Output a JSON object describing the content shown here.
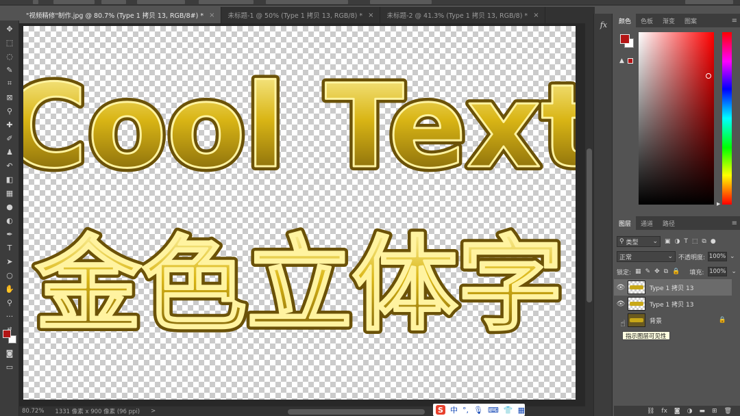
{
  "document_tabs": [
    {
      "label": "\"视频精修\"制作.jpg @ 80.7% (Type 1 拷贝 13, RGB/8#) *",
      "active": true
    },
    {
      "label": "未标题-1 @ 50% (Type 1 拷贝 13, RGB/8) *",
      "active": false
    },
    {
      "label": "未标题-2 @ 41.3% (Type 1 拷贝 13, RGB/8) *",
      "active": false
    }
  ],
  "tab_close": "×",
  "canvas_text": {
    "line1": "Cool Text",
    "line2": "金色立体字"
  },
  "status_bar": {
    "zoom": "80.72%",
    "doc_size": "1331 像素 x 900 像素 (96 ppi)",
    "arrow": ">"
  },
  "ime": {
    "logo": "S",
    "lang": "中",
    "punct": "°,"
  },
  "color_panel": {
    "tabs": [
      "颜色",
      "色板",
      "渐变",
      "图案"
    ],
    "menu": "≡",
    "foreground": "#b41515",
    "background": "#ffffff"
  },
  "layers_panel": {
    "tabs": [
      "图层",
      "通道",
      "路径"
    ],
    "menu": "≡",
    "filter_kind": "类型",
    "blend_mode": "正常",
    "opacity_label": "不透明度:",
    "opacity_value": "100%",
    "lock_label": "锁定:",
    "fill_label": "填充:",
    "fill_value": "100%",
    "layers": [
      {
        "name": "Type 1 拷贝  13",
        "visible": true,
        "selected": true
      },
      {
        "name": "Type 1 拷贝  13",
        "visible": true,
        "selected": false
      },
      {
        "name": "背景",
        "visible": false,
        "selected": false,
        "locked": true
      }
    ],
    "tooltip": "指示图层可见性"
  },
  "fx_button": "fx",
  "colors": {
    "gold_light": "#fff6a8",
    "gold_mid": "#d9b515",
    "gold_dark": "#6b5208"
  }
}
